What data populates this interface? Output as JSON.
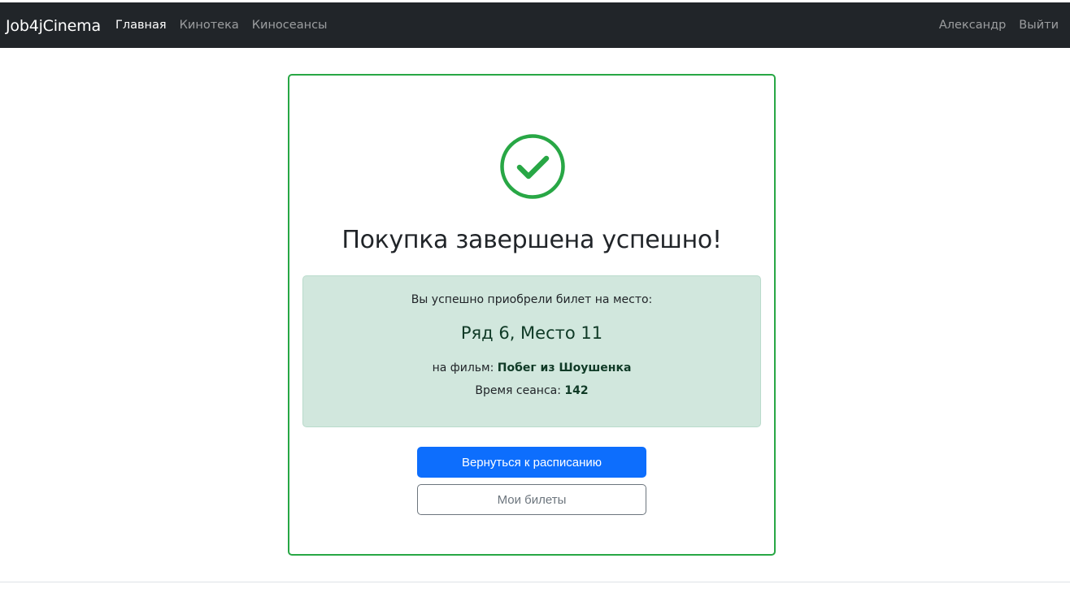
{
  "navbar": {
    "brand": "Job4jCinema",
    "links": [
      {
        "label": "Главная",
        "active": true
      },
      {
        "label": "Кинотека",
        "active": false
      },
      {
        "label": "Киносеансы",
        "active": false
      }
    ],
    "user_name": "Александр",
    "logout_label": "Выйти"
  },
  "success": {
    "icon": "check-circle-icon",
    "title": "Покупка завершена успешно!",
    "intro": "Вы успешно приобрели билет на место:",
    "seat": "Ряд 6, Место 11",
    "film_prefix": "на фильм:",
    "film_name": "Побег из Шоушенка",
    "time_prefix": "Время сеанса:",
    "time_value": "142"
  },
  "actions": {
    "back_label": "Вернуться к расписанию",
    "tickets_label": "Мои билеты"
  },
  "colors": {
    "navbar_bg": "#212529",
    "success_green": "#28a745",
    "alert_bg": "#d1e7dd",
    "primary_blue": "#0d6efd",
    "outline_gray": "#6c757d"
  }
}
